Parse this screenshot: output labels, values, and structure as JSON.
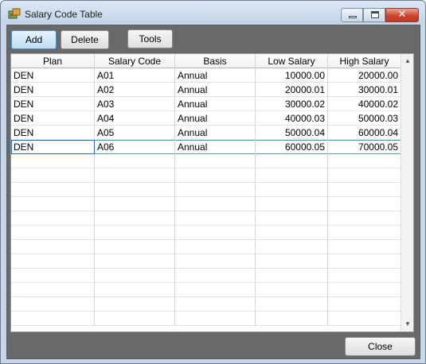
{
  "window": {
    "title": "Salary Code Table"
  },
  "toolbar": {
    "add_label": "Add",
    "delete_label": "Delete",
    "tools_label": "Tools"
  },
  "grid": {
    "columns": [
      "Plan",
      "Salary Code",
      "Basis",
      "Low Salary",
      "High Salary"
    ],
    "rows": [
      [
        "DEN",
        "A01",
        "Annual",
        "10000.00",
        "20000.00"
      ],
      [
        "DEN",
        "A02",
        "Annual",
        "20000.01",
        "30000.01"
      ],
      [
        "DEN",
        "A03",
        "Annual",
        "30000.02",
        "40000.02"
      ],
      [
        "DEN",
        "A04",
        "Annual",
        "40000.03",
        "50000.03"
      ],
      [
        "DEN",
        "A05",
        "Annual",
        "50000.04",
        "60000.04"
      ],
      [
        "DEN",
        "A06",
        "Annual",
        "60000.05",
        "70000.05"
      ]
    ],
    "selected_row": 5
  },
  "footer": {
    "close_label": "Close"
  },
  "icons": {
    "app": "app-icon",
    "minimize": "minimize-icon",
    "maximize": "maximize-icon",
    "close": "close-icon",
    "scroll_up": "scroll-up-arrow-icon",
    "scroll_down": "scroll-down-arrow-icon"
  },
  "colors": {
    "client_background": "#696969",
    "active_button": "#bfdcf3",
    "window_close": "#c9442c"
  }
}
